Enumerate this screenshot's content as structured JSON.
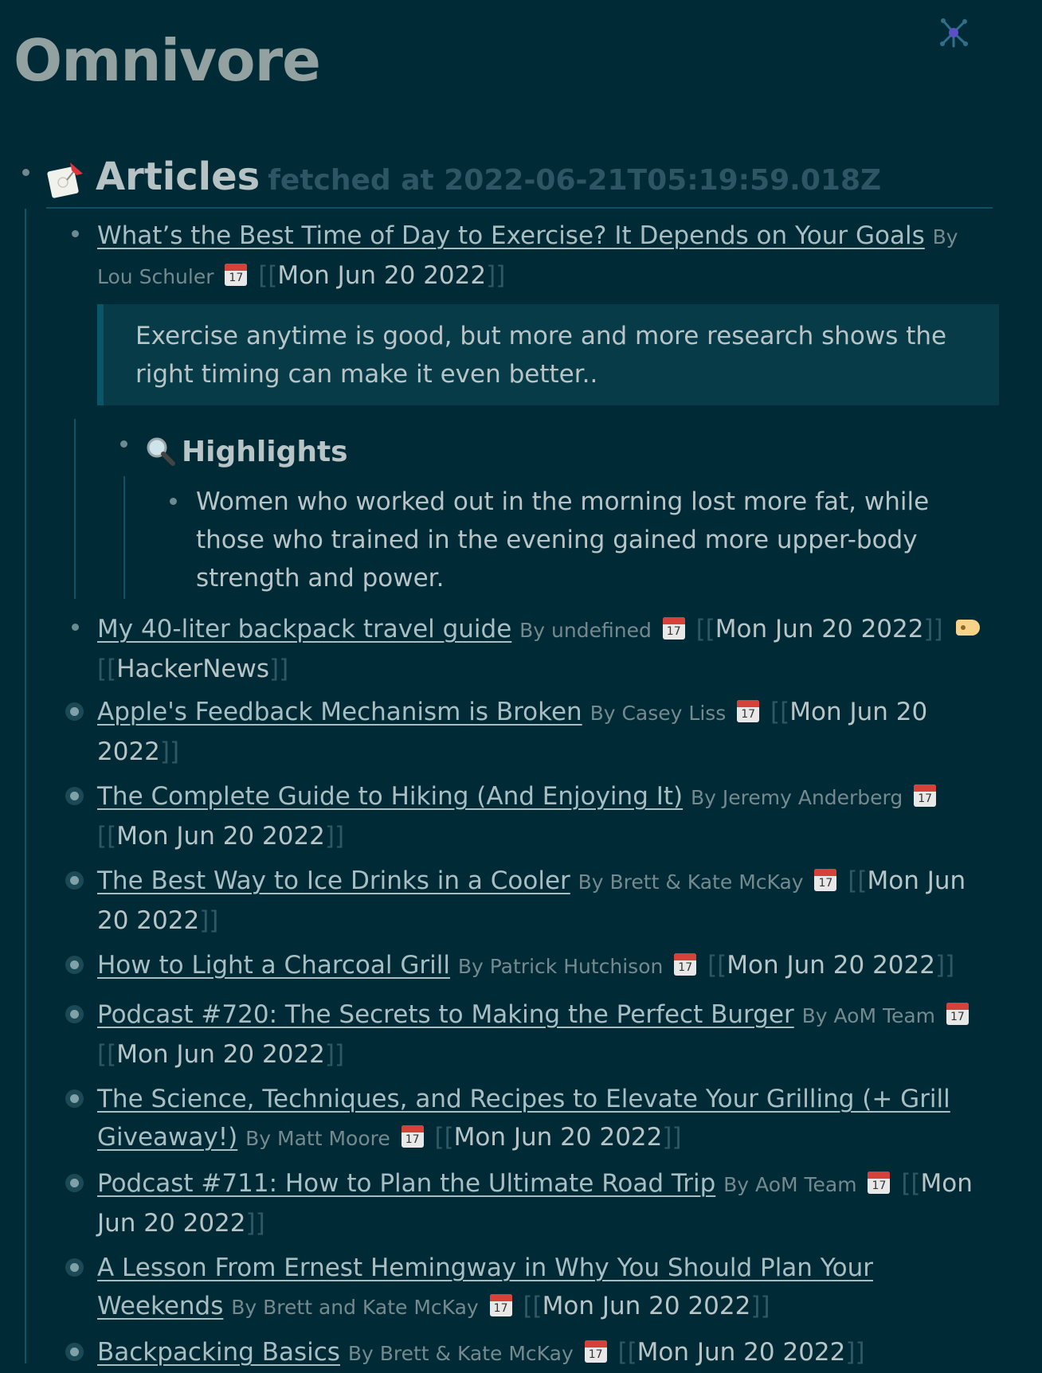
{
  "page": {
    "title": "Omnivore"
  },
  "section": {
    "title": "Articles",
    "meta": "fetched at 2022-06-21T05:19:59.018Z"
  },
  "calendar_day": "17",
  "articles": [
    {
      "title": "What’s the Best Time of Day to Exercise? It Depends on Your Goals",
      "author": "By Lou Schuler",
      "date": "Mon Jun 20 2022",
      "summary": "Exercise anytime is good, but more and more research shows the right timing can make it even better..",
      "highlights_label": "Highlights",
      "highlights": [
        "Women who worked out in the morning lost more fat, while those who trained in the evening gained more upper-body strength and power."
      ]
    },
    {
      "title": "My 40-liter backpack travel guide",
      "author": "By undefined",
      "date": "Mon Jun 20 2022",
      "tag": "HackerNews"
    },
    {
      "title": "Apple's Feedback Mechanism is Broken",
      "author": "By Casey Liss",
      "date": "Mon Jun 20 2022"
    },
    {
      "title": "The Complete Guide to Hiking (And Enjoying It)",
      "author": "By Jeremy Anderberg",
      "date": "Mon Jun 20 2022"
    },
    {
      "title": "The Best Way to Ice Drinks in a Cooler",
      "author": "By Brett & Kate McKay",
      "date": "Mon Jun 20 2022"
    },
    {
      "title": "How to Light a Charcoal Grill",
      "author": "By Patrick Hutchison",
      "date": "Mon Jun 20 2022"
    },
    {
      "title": "Podcast #720: The Secrets to Making the Perfect Burger",
      "author": "By AoM Team",
      "date": "Mon Jun 20 2022"
    },
    {
      "title": "The Science, Techniques, and Recipes to Elevate Your Grilling (+ Grill Giveaway!)",
      "author": "By Matt Moore",
      "date": "Mon Jun 20 2022"
    },
    {
      "title": "Podcast #711: How to Plan the Ultimate Road Trip",
      "author": "By AoM Team",
      "date": "Mon Jun 20 2022"
    },
    {
      "title": "A Lesson From Ernest Hemingway in Why You Should Plan Your Weekends",
      "author": "By Brett and Kate McKay",
      "date": "Mon Jun 20 2022"
    },
    {
      "title": "Backpacking Basics",
      "author": "By Brett & Kate McKay",
      "date": "Mon Jun 20 2022"
    }
  ],
  "colors": {
    "background": "#002b36",
    "text": "#b8c4c6",
    "muted": "#75898e",
    "bracket": "#2f5866",
    "quote_bg": "#073b48"
  }
}
